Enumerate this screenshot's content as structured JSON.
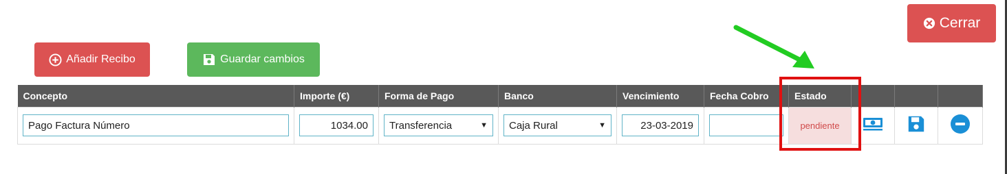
{
  "buttons": {
    "cerrar": "Cerrar",
    "add_receipt": "Añadir Recibo",
    "save_changes": "Guardar cambios"
  },
  "table": {
    "headers": [
      "Concepto",
      "Importe (€)",
      "Forma de Pago",
      "Banco",
      "Vencimiento",
      "Fecha Cobro",
      "Estado"
    ],
    "row": {
      "concepto": "Pago Factura Número",
      "importe": "1034.00",
      "forma_pago": "Transferencia",
      "banco": "Caja Rural",
      "vencimiento": "23-03-2019",
      "fecha_cobro": "",
      "estado": "pendiente"
    }
  },
  "icons": {
    "cash": "cash-icon",
    "save": "floppy-disk-icon",
    "remove": "minus-circle-icon",
    "close": "times-circle-icon",
    "add": "plus-circle-icon"
  },
  "colors": {
    "danger": "#dc5252",
    "success": "#5cb85c",
    "header": "#595959",
    "accent_blue": "#1a8fd6",
    "status_pending_bg": "#f6dede",
    "status_pending_text": "#d04a4a",
    "annotation_red": "#e01111",
    "annotation_arrow": "#22cc22"
  }
}
